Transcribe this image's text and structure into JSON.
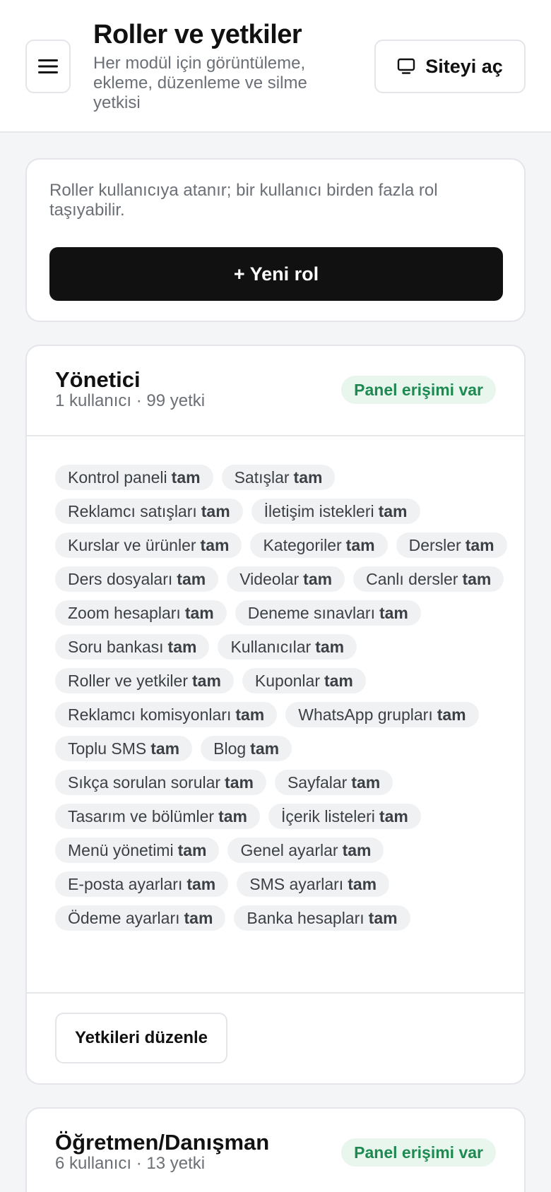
{
  "header": {
    "title": "Roller ve yetkiler",
    "subtitle": "Her modül için görüntüleme, ekleme, düzenleme ve silme yetkisi",
    "menu_icon": "hamburger-menu-icon",
    "site_button_icon": "monitor-icon",
    "site_button_label": "Siteyi aç"
  },
  "intro": {
    "text": "Roller kullanıcıya atanır; bir kullanıcı birden fazla rol taşıyabilir.",
    "new_role_label": "+ Yeni rol"
  },
  "roles": [
    {
      "name": "Yönetici",
      "meta": "1 kullanıcı · 99 yetki",
      "badge": "Panel erişimi var",
      "edit_label": "Yetkileri düzenle",
      "permissions": [
        {
          "module": "Kontrol paneli",
          "level": "tam"
        },
        {
          "module": "Satışlar",
          "level": "tam"
        },
        {
          "module": "Reklamcı satışları",
          "level": "tam"
        },
        {
          "module": "İletişim istekleri",
          "level": "tam"
        },
        {
          "module": "Kurslar ve ürünler",
          "level": "tam"
        },
        {
          "module": "Kategoriler",
          "level": "tam"
        },
        {
          "module": "Dersler",
          "level": "tam"
        },
        {
          "module": "Ders dosyaları",
          "level": "tam"
        },
        {
          "module": "Videolar",
          "level": "tam"
        },
        {
          "module": "Canlı dersler",
          "level": "tam"
        },
        {
          "module": "Zoom hesapları",
          "level": "tam"
        },
        {
          "module": "Deneme sınavları",
          "level": "tam"
        },
        {
          "module": "Soru bankası",
          "level": "tam"
        },
        {
          "module": "Kullanıcılar",
          "level": "tam"
        },
        {
          "module": "Roller ve yetkiler",
          "level": "tam"
        },
        {
          "module": "Kuponlar",
          "level": "tam"
        },
        {
          "module": "Reklamcı komisyonları",
          "level": "tam"
        },
        {
          "module": "WhatsApp grupları",
          "level": "tam"
        },
        {
          "module": "Toplu SMS",
          "level": "tam"
        },
        {
          "module": "Blog",
          "level": "tam"
        },
        {
          "module": "Sıkça sorulan sorular",
          "level": "tam"
        },
        {
          "module": "Sayfalar",
          "level": "tam"
        },
        {
          "module": "Tasarım ve bölümler",
          "level": "tam"
        },
        {
          "module": "İçerik listeleri",
          "level": "tam"
        },
        {
          "module": "Menü yönetimi",
          "level": "tam"
        },
        {
          "module": "Genel ayarlar",
          "level": "tam"
        },
        {
          "module": "E-posta ayarları",
          "level": "tam"
        },
        {
          "module": "SMS ayarları",
          "level": "tam"
        },
        {
          "module": "Ödeme ayarları",
          "level": "tam"
        },
        {
          "module": "Banka hesapları",
          "level": "tam"
        }
      ]
    },
    {
      "name": "Öğretmen/Danışman",
      "meta": "6 kullanıcı · 13 yetki",
      "badge": "Panel erişimi var"
    }
  ]
}
